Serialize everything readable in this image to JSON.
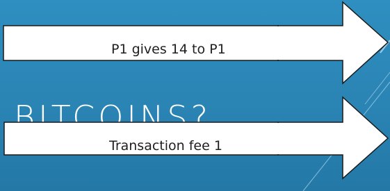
{
  "slide": {
    "title": "BITCOINS?",
    "background_color": "#2a84b4",
    "arrows": [
      {
        "label": "P1 gives 14 to P1"
      },
      {
        "label": "Transaction fee 1"
      }
    ]
  }
}
